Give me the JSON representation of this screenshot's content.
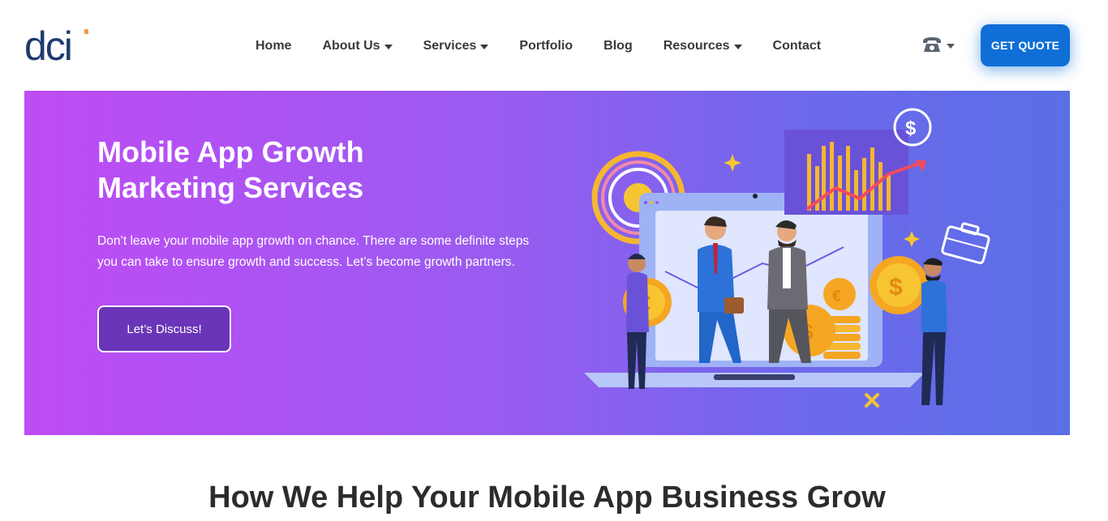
{
  "brand": {
    "logo_text": "dci",
    "colors": {
      "logo_blue": "#1e3a6e",
      "logo_dot": "#f2994a",
      "accent_blue": "#0f6fd6",
      "hero_start": "#bf4cf5",
      "hero_end": "#5a6fe6"
    }
  },
  "nav": {
    "items": [
      {
        "label": "Home",
        "dropdown": false
      },
      {
        "label": "About Us",
        "dropdown": true
      },
      {
        "label": "Services",
        "dropdown": true
      },
      {
        "label": "Portfolio",
        "dropdown": false
      },
      {
        "label": "Blog",
        "dropdown": false
      },
      {
        "label": "Resources",
        "dropdown": true
      },
      {
        "label": "Contact",
        "dropdown": false
      }
    ],
    "phone_icon": "phone-icon",
    "quote_label": "GET QUOTE"
  },
  "hero": {
    "title_line1": "Mobile App Growth",
    "title_line2": "Marketing Services",
    "description": "Don’t leave your mobile app growth on chance. There are some definite steps you can take to ensure growth and success. Let’s become growth partners.",
    "cta_label": "Let’s Discuss!"
  },
  "section": {
    "title": "How We Help Your Mobile App Business Grow"
  }
}
